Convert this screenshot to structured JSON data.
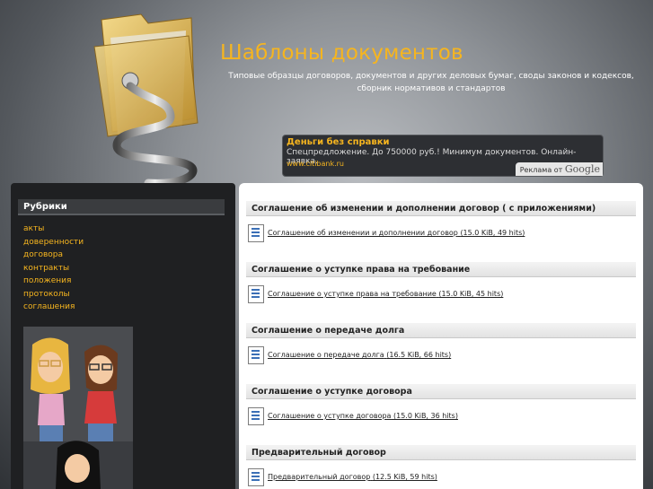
{
  "site": {
    "title": "Шаблоны документов",
    "tagline": "Типовые образцы договоров, документов и других деловых бумаг, своды законов и кодексов, сборник нормативов и стандартов"
  },
  "ad": {
    "title": "Деньги без справки",
    "text": "Спецпредложение. До 750000 руб.! Минимум документов. Онлайн-заявка.",
    "url": "www.citibank.ru",
    "badge_prefix": "Реклама от",
    "badge_brand": "Google"
  },
  "sidebar": {
    "title": "Рубрики",
    "items": [
      "акты",
      "доверенности",
      "договора",
      "контракты",
      "положения",
      "протоколы",
      "соглашения"
    ]
  },
  "sections": [
    {
      "title": "Соглашение об изменении и дополнении договор ( с приложениями)",
      "link": "Соглашение об изменении и дополнении договор",
      "meta": "(15.0 KiB, 49 hits)"
    },
    {
      "title": "Соглашение о уступке права на требование",
      "link": "Соглашение о уступке права на требование",
      "meta": "(15.0 KiB, 45 hits)"
    },
    {
      "title": "Соглашение о передаче долга",
      "link": "Соглашение о передаче долга",
      "meta": "(16.5 KiB, 66 hits)"
    },
    {
      "title": "Соглашение о уступке договора",
      "link": "Соглашение о уступке договора",
      "meta": "(15.0 KiB, 36 hits)"
    },
    {
      "title": "Предварительный договор",
      "link": "Предварительный договор",
      "meta": "(12.5 KiB, 59 hits)"
    }
  ],
  "colors": {
    "accent": "#f6b51f",
    "sidebar_bg": "#1f2022",
    "content_bg": "#ffffff"
  }
}
